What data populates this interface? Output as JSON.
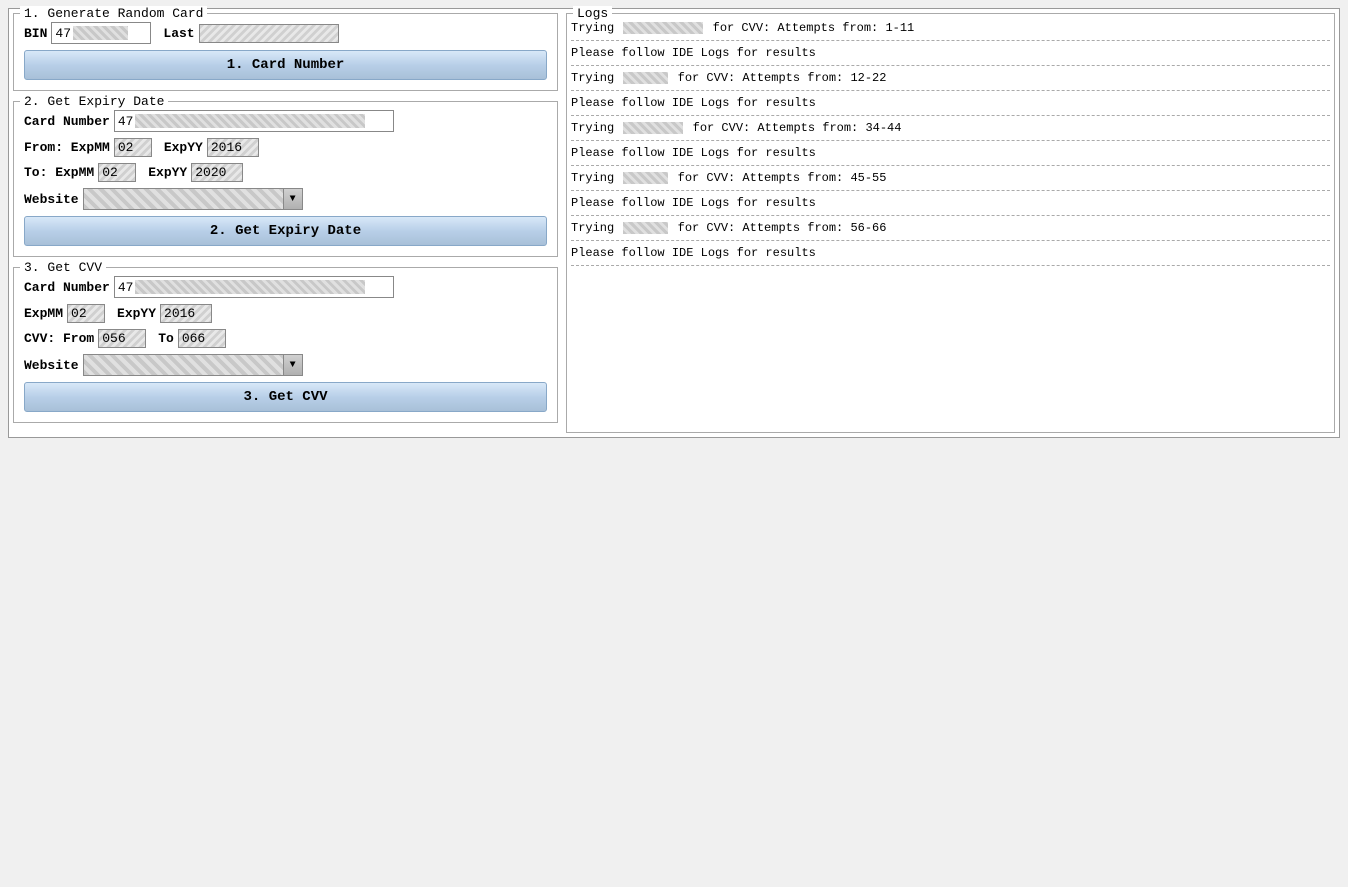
{
  "sections": {
    "section1": {
      "title": "1. Generate Random Card",
      "bin_label": "BIN",
      "bin_prefix": "47",
      "last_label": "Last",
      "last_value": "",
      "button_label": "1.    Card Number"
    },
    "section2": {
      "title": "2. Get Expiry Date",
      "card_number_label": "Card Number",
      "card_number_prefix": "47",
      "from_label": "From: ExpMM",
      "from_mm": "02",
      "from_yy_label": "ExpYY",
      "from_yy": "2016",
      "to_label": "To: ExpMM",
      "to_mm": "02",
      "to_yy_label": "ExpYY",
      "to_yy": "2020",
      "website_label": "Website",
      "button_label": "2. Get Expiry Date"
    },
    "section3": {
      "title": "3. Get CVV",
      "card_number_label": "Card Number",
      "card_number_prefix": "47",
      "expmm_label": "ExpMM",
      "expmm_value": "02",
      "expyy_label": "ExpYY",
      "expyy_value": "2016",
      "cvv_from_label": "CVV: From",
      "cvv_from": "056",
      "cvv_to_label": "To",
      "cvv_to": "066",
      "website_label": "Website",
      "button_label": "3. Get CVV"
    }
  },
  "logs": {
    "title": "Logs",
    "entries": [
      {
        "type": "log",
        "text_before": "Trying",
        "redacted_size": "large",
        "text_after": "for CVV: Attempts from: 1-11"
      },
      {
        "type": "divider"
      },
      {
        "type": "plain",
        "text": "Please follow IDE Logs for results"
      },
      {
        "type": "divider"
      },
      {
        "type": "log",
        "text_before": "Trying",
        "redacted_size": "small",
        "text_after": "for CVV: Attempts from: 12-22"
      },
      {
        "type": "divider"
      },
      {
        "type": "plain",
        "text": "Please follow IDE Logs for results"
      },
      {
        "type": "divider"
      },
      {
        "type": "log",
        "text_before": "Trying",
        "redacted_size": "medium",
        "text_after": "for CVV: Attempts from: 34-44"
      },
      {
        "type": "divider"
      },
      {
        "type": "plain",
        "text": "Please follow IDE Logs for results"
      },
      {
        "type": "divider"
      },
      {
        "type": "log",
        "text_before": "Trying",
        "redacted_size": "small",
        "text_after": "for CVV: Attempts from: 45-55"
      },
      {
        "type": "divider"
      },
      {
        "type": "plain",
        "text": "Please follow IDE Logs for results"
      },
      {
        "type": "divider"
      },
      {
        "type": "log",
        "text_before": "Trying",
        "redacted_size": "small",
        "text_after": "for CVV: Attempts from: 56-66"
      },
      {
        "type": "divider"
      },
      {
        "type": "plain",
        "text": "Please follow IDE Logs for results"
      },
      {
        "type": "divider"
      }
    ]
  }
}
